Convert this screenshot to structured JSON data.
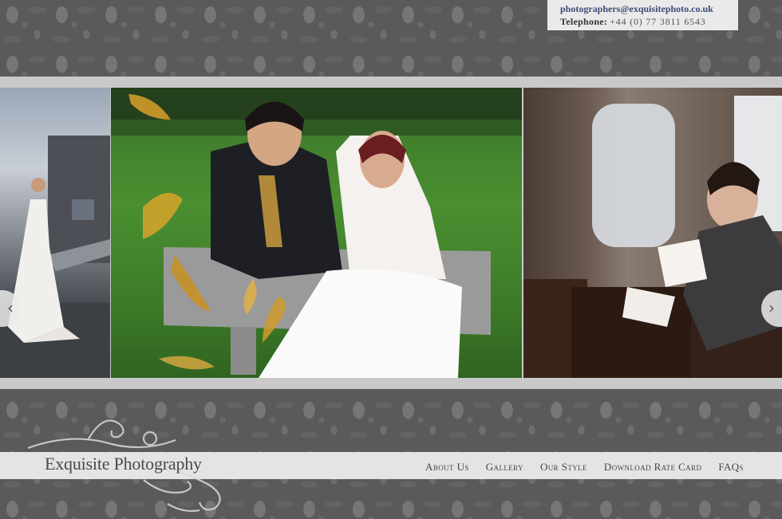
{
  "contact": {
    "email": "photographers@exquisitephoto.co.uk",
    "phone_label": "Telephone:",
    "phone_number": "+44 (0) 77 3811 6543"
  },
  "slider": {
    "prev_icon": "chevron-left-icon",
    "next_icon": "chevron-right-icon",
    "prev_glyph": "‹",
    "next_glyph": "›",
    "slides": [
      {
        "subject": "bride standing on bridge"
      },
      {
        "subject": "couple sitting on bench in garden"
      },
      {
        "subject": "groom reading letter in church pew"
      }
    ]
  },
  "brand": {
    "name": "Exquisite Photography"
  },
  "nav": {
    "items": [
      {
        "label": "About Us"
      },
      {
        "label": "Gallery"
      },
      {
        "label": "Our Style"
      },
      {
        "label": "Download Rate Card"
      },
      {
        "label": "FAQs"
      }
    ]
  },
  "colors": {
    "accent_link": "#3f4a75",
    "band": "#c9c9c9",
    "nav_bar": "#e4e4e4",
    "damask_bg": "#5a5a5a"
  }
}
